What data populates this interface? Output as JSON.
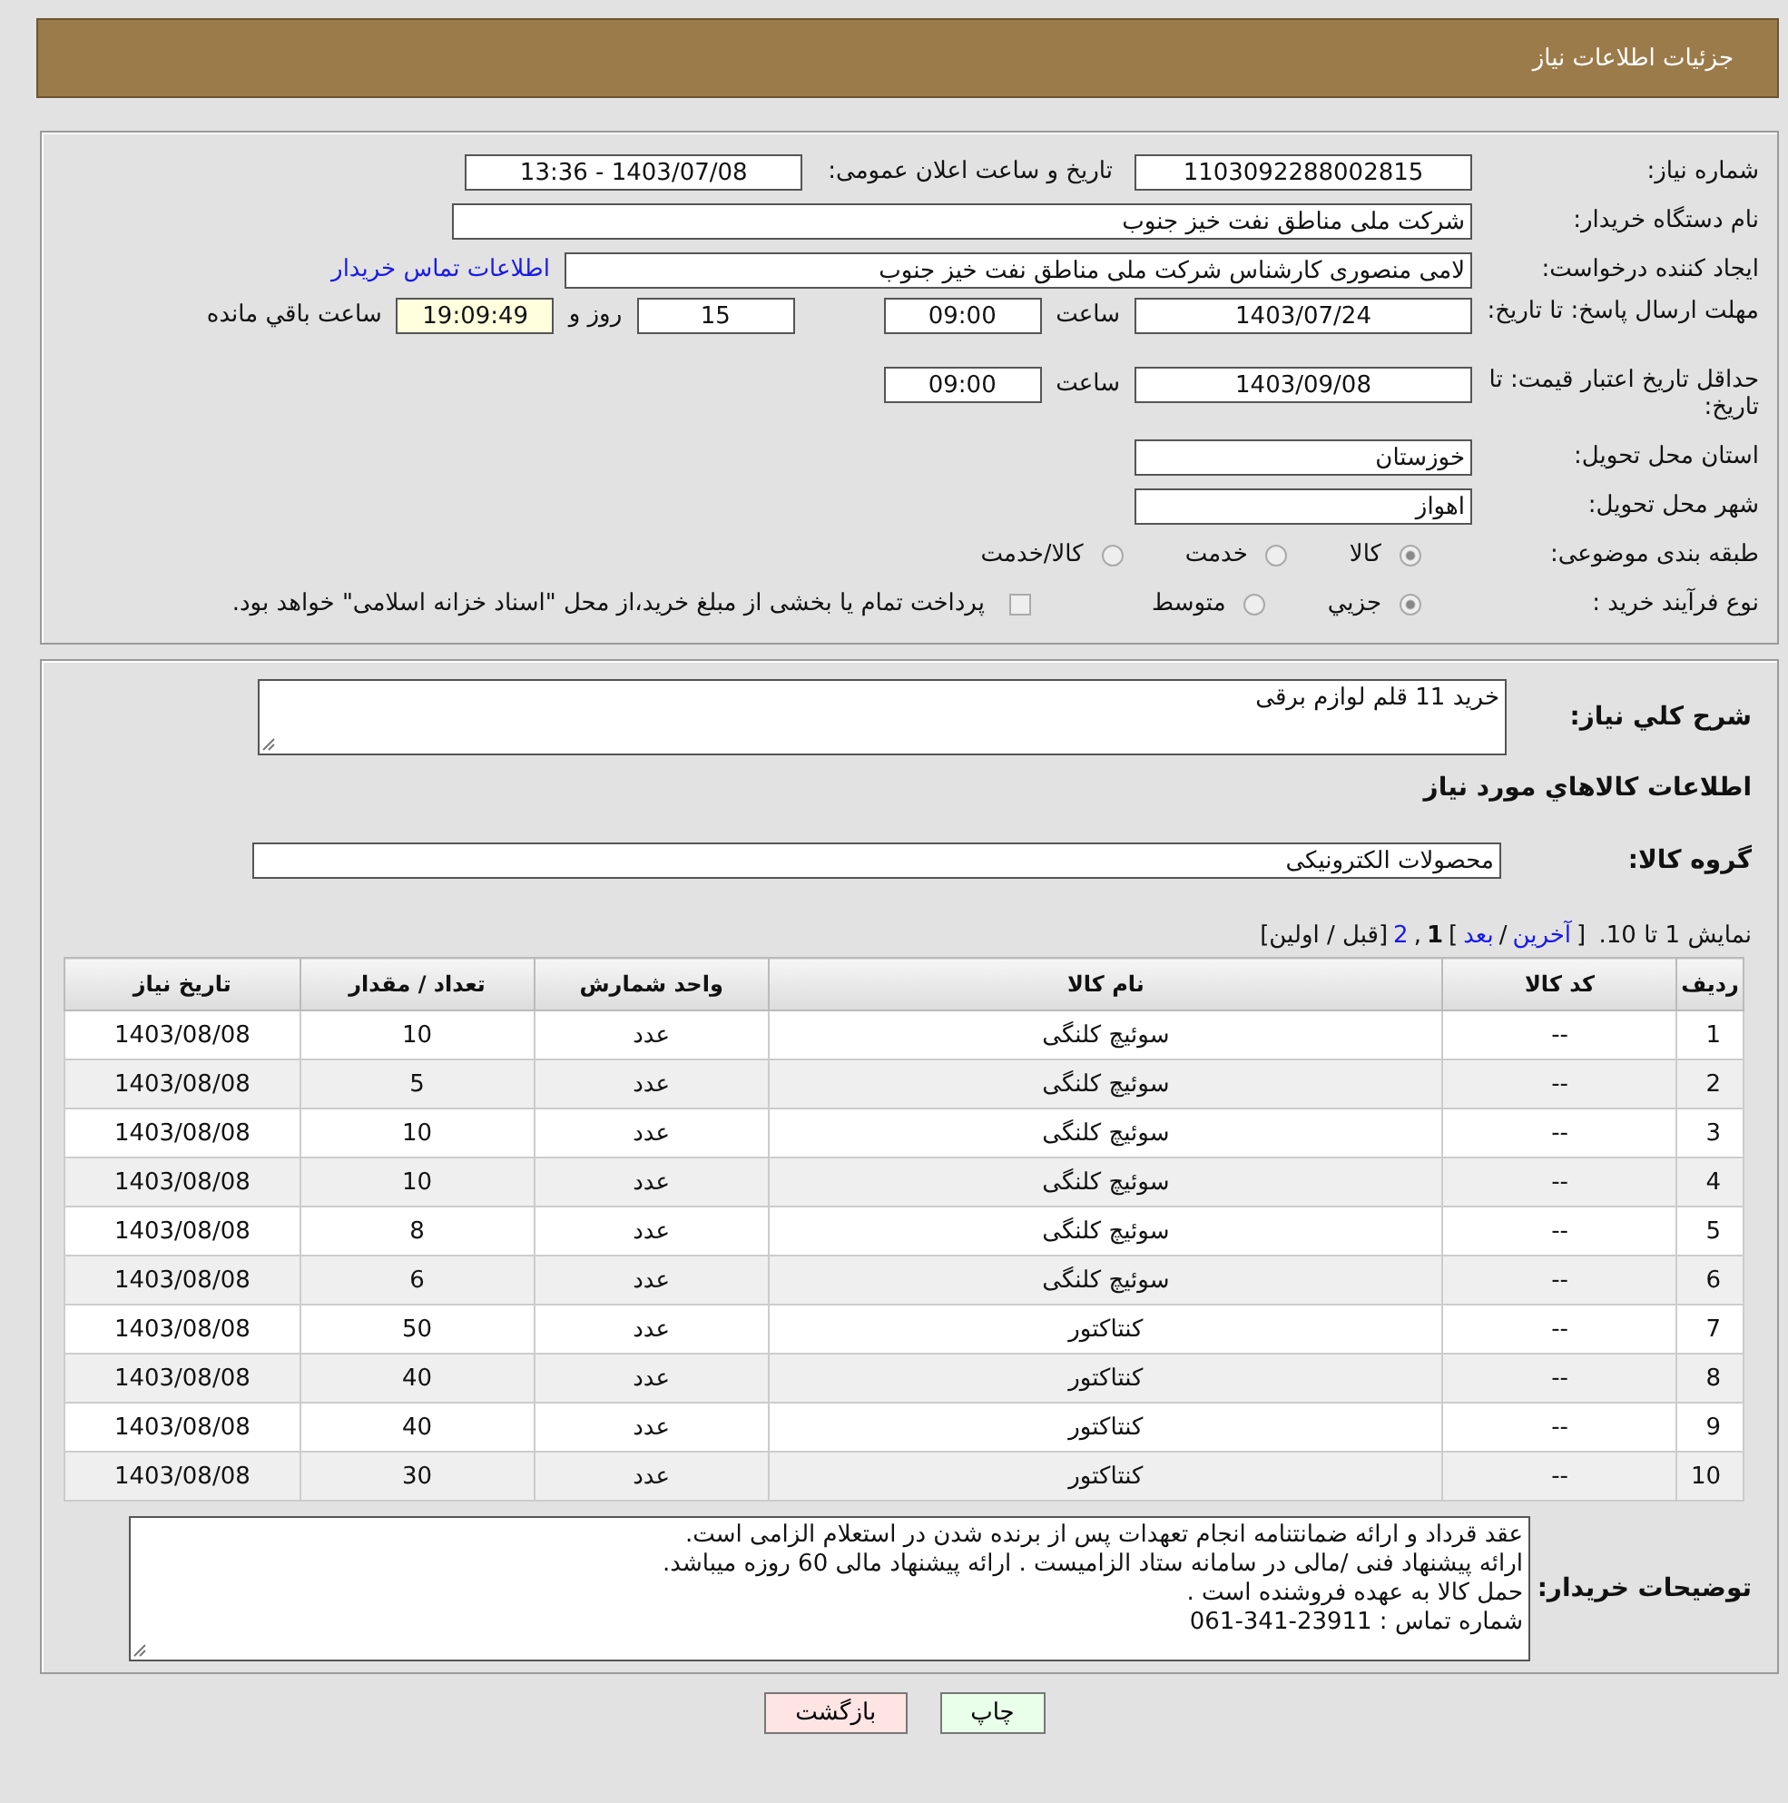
{
  "header": {
    "title": "جزئیات اطلاعات نیاز"
  },
  "need_number": {
    "label": "شماره نیاز:",
    "value": "1103092288002815"
  },
  "announce": {
    "label": "تاریخ و ساعت اعلان عمومی:",
    "value": "1403/07/08 - 13:36"
  },
  "buyer": {
    "label": "نام دستگاه خریدار:",
    "value": "شرکت ملی مناطق نفت خیز جنوب"
  },
  "requester": {
    "label": "ایجاد کننده درخواست:",
    "value": "لامی منصوری کارشناس شرکت ملی مناطق نفت خیز جنوب",
    "link": "اطلاعات تماس خریدار"
  },
  "reply_deadline": {
    "label": "مهلت ارسال پاسخ: تا تاریخ:",
    "date": "1403/07/24",
    "time_label": "ساعت",
    "time": "09:00",
    "days": "15",
    "days_label": "روز و",
    "remaining": "19:09:49",
    "remaining_label": "ساعت باقي مانده"
  },
  "validity": {
    "label": "حداقل تاریخ اعتبار قیمت: تا تاریخ:",
    "date": "1403/09/08",
    "time_label": "ساعت",
    "time": "09:00"
  },
  "province": {
    "label": "استان محل تحویل:",
    "value": "خوزستان"
  },
  "city": {
    "label": "شهر محل تحویل:",
    "value": "اهواز"
  },
  "category": {
    "label": "طبقه بندی موضوعی:",
    "options": [
      {
        "label": "کالا",
        "selected": true
      },
      {
        "label": "خدمت",
        "selected": false
      },
      {
        "label": "کالا/خدمت",
        "selected": false
      }
    ]
  },
  "purchase_type": {
    "label": "نوع فرآیند خرید :",
    "options": [
      {
        "label": "جزيي",
        "selected": true
      },
      {
        "label": "متوسط",
        "selected": false
      }
    ],
    "payment": {
      "checked": false,
      "text": "پرداخت تمام یا بخشی از مبلغ خرید،از محل \"اسناد خزانه اسلامی\" خواهد بود."
    }
  },
  "description": {
    "label": "شرح كلي نياز:",
    "value": "خرید 11 قلم لوازم برقی"
  },
  "goods_title": "اطلاعات كالاهاي مورد نياز",
  "group": {
    "label": "گروه كالا:",
    "value": "محصولات الکترونیکی"
  },
  "pager": {
    "summary": "نمایش 1 تا 10.",
    "parts": [
      {
        "kind": "plain",
        "text": "["
      },
      {
        "kind": "link",
        "text": "آخرین"
      },
      {
        "kind": "plain",
        "text": "/"
      },
      {
        "kind": "link",
        "text": "بعد"
      },
      {
        "kind": "plain",
        "text": "]"
      },
      {
        "kind": "link",
        "text": "2"
      },
      {
        "kind": "plain",
        "text": ","
      },
      {
        "kind": "current",
        "text": "1"
      },
      {
        "kind": "plain",
        "text": "[قبل / اولین]"
      }
    ]
  },
  "table": {
    "columns": [
      "ردیف",
      "کد کالا",
      "نام کالا",
      "واحد شمارش",
      "تعداد / مقدار",
      "تاریخ نیاز"
    ],
    "rows": [
      [
        "1",
        "--",
        "سوئیچ کلنگی",
        "عدد",
        "10",
        "1403/08/08"
      ],
      [
        "2",
        "--",
        "سوئیچ کلنگی",
        "عدد",
        "5",
        "1403/08/08"
      ],
      [
        "3",
        "--",
        "سوئیچ کلنگی",
        "عدد",
        "10",
        "1403/08/08"
      ],
      [
        "4",
        "--",
        "سوئیچ کلنگی",
        "عدد",
        "10",
        "1403/08/08"
      ],
      [
        "5",
        "--",
        "سوئیچ کلنگی",
        "عدد",
        "8",
        "1403/08/08"
      ],
      [
        "6",
        "--",
        "سوئیچ کلنگی",
        "عدد",
        "6",
        "1403/08/08"
      ],
      [
        "7",
        "--",
        "کنتاکتور",
        "عدد",
        "50",
        "1403/08/08"
      ],
      [
        "8",
        "--",
        "کنتاکتور",
        "عدد",
        "40",
        "1403/08/08"
      ],
      [
        "9",
        "--",
        "کنتاکتور",
        "عدد",
        "40",
        "1403/08/08"
      ],
      [
        "10",
        "--",
        "کنتاکتور",
        "عدد",
        "30",
        "1403/08/08"
      ]
    ]
  },
  "buyer_notes": {
    "label": "توضیحات خریدار:",
    "value": "عقد قرداد و ارائه ضمانتنامه انجام تعهدات پس از برنده شدن در استعلام الزامی است.\nارائه پیشنهاد فنی /مالی در سامانه ستاد الزامیست . ارائه پیشنهاد مالی 60 روزه میباشد.\nحمل کالا به عهده فروشنده است .\nشماره تماس : 23911-341-061"
  },
  "buttons": [
    {
      "kind": "print",
      "label": "چاپ"
    },
    {
      "kind": "back",
      "label": "بازگشت"
    }
  ]
}
